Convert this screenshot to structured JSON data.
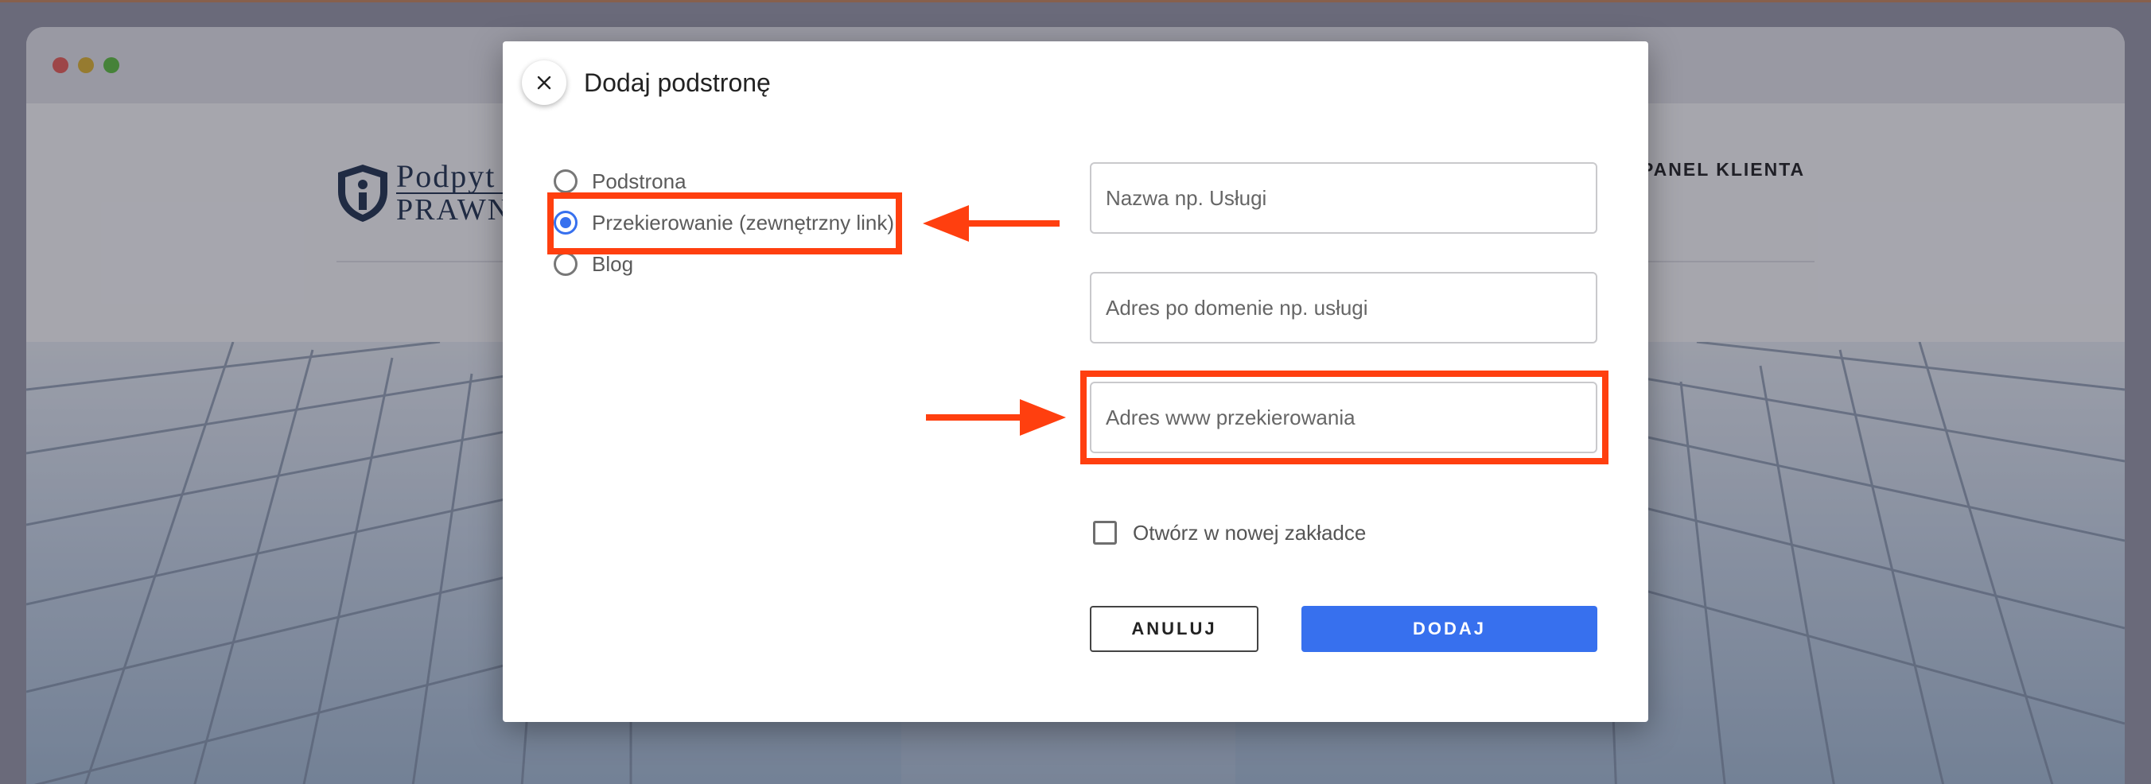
{
  "modal": {
    "title": "Dodaj podstronę",
    "page_type_options": [
      {
        "label": "Podstrona",
        "selected": false
      },
      {
        "label": "Przekierowanie (zewnętrzny link)",
        "selected": true
      },
      {
        "label": "Blog",
        "selected": false
      }
    ],
    "fields": {
      "name": {
        "value": "",
        "placeholder": "Nazwa np. Usługi"
      },
      "slug": {
        "value": "",
        "placeholder": "Adres po domenie np. usługi"
      },
      "redirect_url": {
        "value": "",
        "placeholder": "Adres www przekierowania"
      }
    },
    "open_in_new_tab": {
      "label": "Otwórz w nowej zakładce",
      "checked": false
    },
    "buttons": {
      "cancel": "ANULUJ",
      "add": "DODAJ"
    }
  },
  "background_site": {
    "logo_line1": "Podpyt",
    "logo_line2": "PRAWNI",
    "nav_item": "PANEL KLIENTA"
  },
  "colors": {
    "accent": "#3770ee",
    "annotation": "#ff3f0f"
  }
}
